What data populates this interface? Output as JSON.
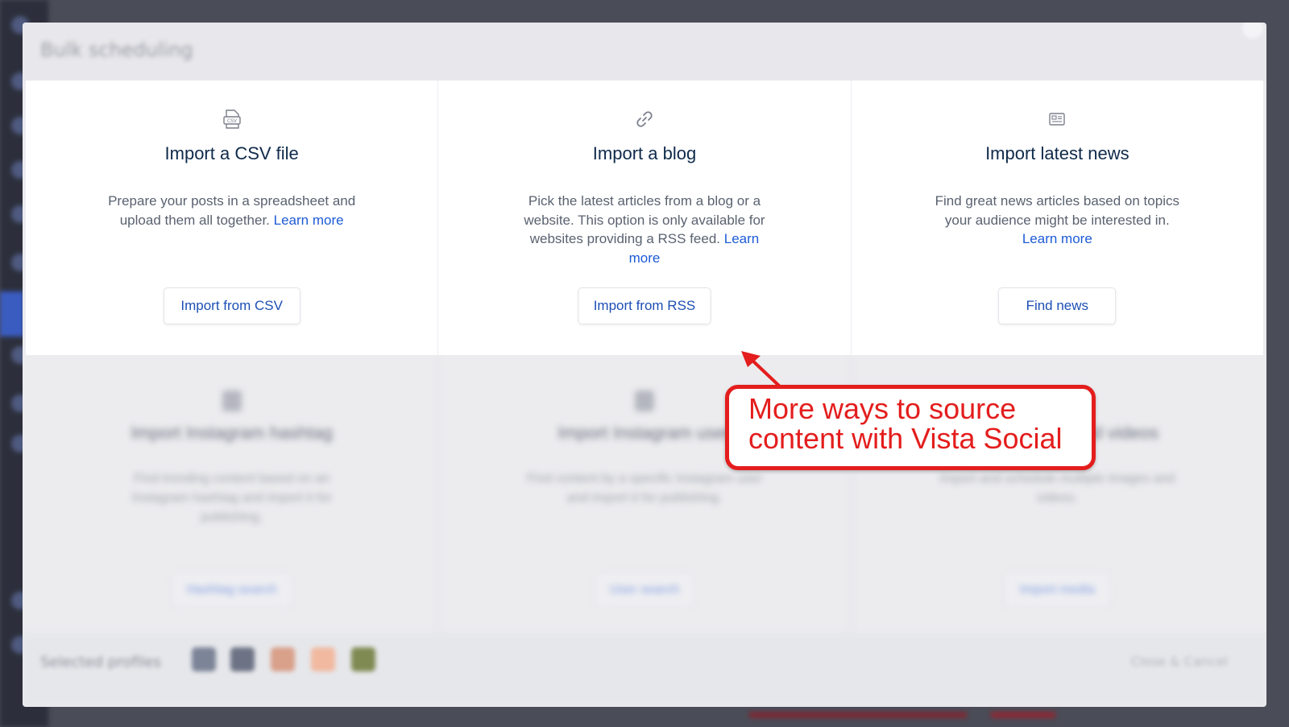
{
  "modal": {
    "title": "Bulk scheduling"
  },
  "options_top": [
    {
      "icon": "csv-file-icon",
      "title": "Import a CSV file",
      "description": "Prepare your posts in a spreadsheet and upload them all together.",
      "link": "Learn more",
      "button": "Import from CSV"
    },
    {
      "icon": "link-icon",
      "title": "Import a blog",
      "description": "Pick the latest articles from a blog or a website. This option is only available for websites providing a RSS feed.",
      "link": "Learn more",
      "button": "Import from RSS"
    },
    {
      "icon": "newspaper-icon",
      "title": "Import latest news",
      "description": "Find great news articles based on topics your audience might be interested in.",
      "link": "Learn more",
      "button": "Find news"
    }
  ],
  "options_bottom": [
    {
      "title": "Import Instagram hashtag",
      "description": "Find trending content based on an Instagram hashtag and import it for publishing.",
      "button": "Hashtag search"
    },
    {
      "title": "Import Instagram user",
      "description": "Find content by a specific Instagram user and import it for publishing.",
      "button": "User search"
    },
    {
      "title": "Import images and videos",
      "description": "Import and schedule multiple images and videos.",
      "button": "Import media"
    }
  ],
  "footer": {
    "label": "Selected profiles",
    "cancel": "Close & Cancel"
  },
  "annotation": {
    "line1": "More ways to source",
    "line2": "content with Vista Social",
    "color": "#e41d1d"
  },
  "colors": {
    "link": "#1d5bd6",
    "title": "#0f2a4a",
    "annotation": "#e41d1d"
  }
}
